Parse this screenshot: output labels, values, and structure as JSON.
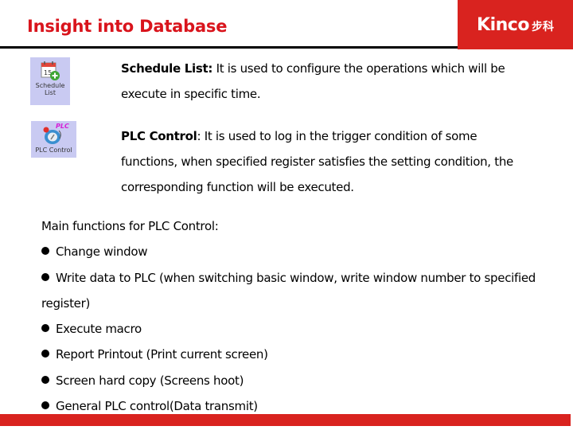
{
  "header": {
    "title": "Insight into Database",
    "logo_text": "Kinco",
    "logo_cn": "步科",
    "accent_color": "#d9231f"
  },
  "icons": {
    "schedule": {
      "name": "calendar-add-icon",
      "label_line1": "Schedule",
      "label_line2": "List",
      "calendar_number": "15"
    },
    "plc": {
      "name": "plc-control-icon",
      "badge": "PLC",
      "label": "PLC Control"
    }
  },
  "sections": [
    {
      "term": "Schedule List:",
      "text": " It is used to configure the operations which will be execute in specific time."
    },
    {
      "term": "PLC Control",
      "text": ": It is used to log in the trigger condition of some functions, when specified register satisfies the setting condition, the corresponding function will be executed."
    }
  ],
  "main_functions": {
    "heading": "Main functions for PLC Control:",
    "items": [
      "Change window",
      "Write data to PLC (when switching basic window, write window number to specified register)",
      "Execute macro",
      "Report Printout (Print current screen)",
      "Screen hard copy (Screens hoot)",
      "General PLC control(Data transmit)"
    ]
  }
}
